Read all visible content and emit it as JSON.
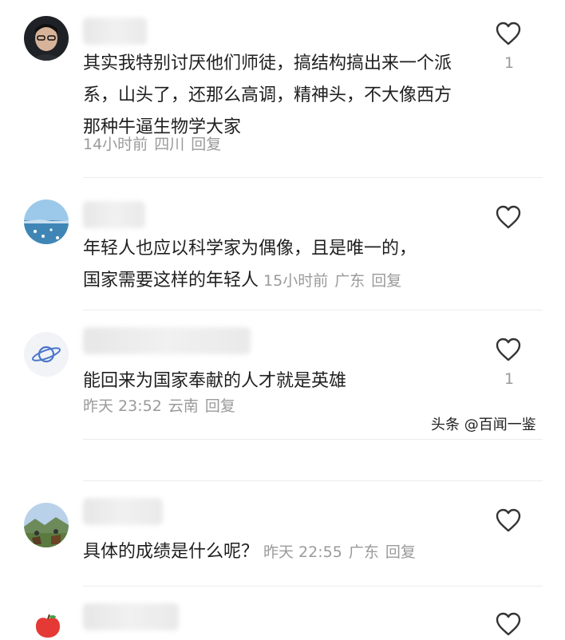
{
  "comments": [
    {
      "text": "其实我特别讨厌他们师徒，搞结构搞出来一个派系，山头了，还那么高调，精神头，不大像西方那种牛逼生物学大家",
      "time": "14小时前",
      "location": "四川",
      "reply": "回复",
      "likes": "1"
    },
    {
      "text_line1": "年轻人也应以科学家为偶像，且是唯一的，",
      "text_line2": "国家需要这样的年轻人",
      "time": "15小时前",
      "location": "广东",
      "reply": "回复",
      "likes": ""
    },
    {
      "text": "能回来为国家奉献的人才就是英雄",
      "time": "昨天 23:52",
      "location": "云南",
      "reply": "回复",
      "likes": "1"
    },
    {
      "text": "具体的成绩是什么呢？",
      "time": "昨天 22:55",
      "location": "广东",
      "reply": "回复",
      "likes": ""
    }
  ],
  "watermark": "头条 @百闻一鉴",
  "icons": {
    "like": "heart-outline-icon",
    "avatar_5": "apple-icon"
  }
}
